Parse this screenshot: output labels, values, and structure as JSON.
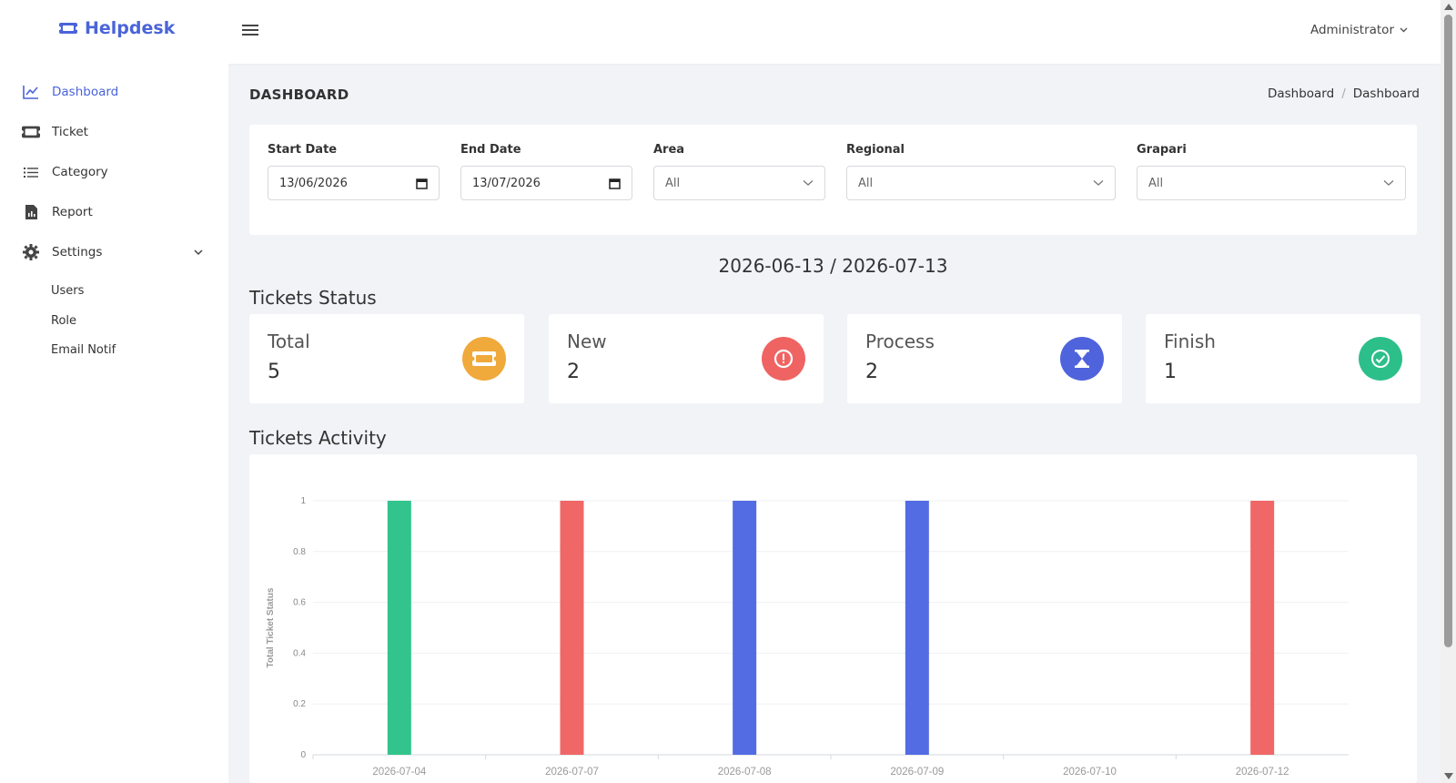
{
  "brand": {
    "name": "Helpdesk"
  },
  "user": {
    "name": "Administrator"
  },
  "sidebar": {
    "items": [
      {
        "label": "Dashboard",
        "icon": "line-chart-icon"
      },
      {
        "label": "Ticket",
        "icon": "ticket-icon"
      },
      {
        "label": "Category",
        "icon": "list-icon"
      },
      {
        "label": "Report",
        "icon": "report-icon"
      },
      {
        "label": "Settings",
        "icon": "gear-icon"
      }
    ],
    "settings_sub": [
      "Users",
      "Role",
      "Email Notif"
    ]
  },
  "page": {
    "title": "DASHBOARD",
    "breadcrumb": [
      "Dashboard",
      "Dashboard"
    ]
  },
  "filters": {
    "start_date": {
      "label": "Start Date",
      "value": "13/06/2026"
    },
    "end_date": {
      "label": "End Date",
      "value": "13/07/2026"
    },
    "area": {
      "label": "Area",
      "value": "All"
    },
    "regional": {
      "label": "Regional",
      "value": "All"
    },
    "grapari": {
      "label": "Grapari",
      "value": "All"
    }
  },
  "date_range": "2026-06-13 / 2026-07-13",
  "status": {
    "title": "Tickets Status",
    "cards": [
      {
        "label": "Total",
        "value": "5",
        "color": "#f0a93b",
        "icon": "ticket-icon"
      },
      {
        "label": "New",
        "value": "2",
        "color": "#ef6462",
        "icon": "alert-icon"
      },
      {
        "label": "Process",
        "value": "2",
        "color": "#4f63dc",
        "icon": "hourglass-icon"
      },
      {
        "label": "Finish",
        "value": "1",
        "color": "#2cbf8a",
        "icon": "check-icon"
      }
    ]
  },
  "activity": {
    "title": "Tickets Activity"
  },
  "chart_data": {
    "type": "bar",
    "categories": [
      "2026-07-04",
      "2026-07-07",
      "2026-07-08",
      "2026-07-09",
      "2026-07-10",
      "2026-07-12"
    ],
    "series": [
      {
        "color": "#33c48d",
        "values": [
          1,
          0,
          0,
          0,
          0,
          0
        ]
      },
      {
        "color": "#f06767",
        "values": [
          0,
          1,
          0,
          0,
          0,
          1
        ]
      },
      {
        "color": "#536be3",
        "values": [
          0,
          0,
          1,
          1,
          0,
          0
        ]
      }
    ],
    "ylabel": "Total Ticket Status",
    "ylim": [
      0,
      1
    ],
    "yticks": [
      "0",
      "0.2",
      "0.4",
      "0.6",
      "0.8",
      "1"
    ],
    "grid": true
  }
}
